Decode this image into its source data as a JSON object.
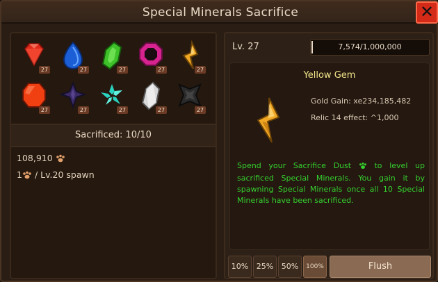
{
  "window": {
    "title": "Special Minerals Sacrifice",
    "close_label": "✕"
  },
  "left": {
    "gems": [
      {
        "name": "red-gem-icon",
        "count": "27",
        "color": "#e02a1a"
      },
      {
        "name": "blue-gem-icon",
        "count": "27",
        "color": "#1b5ed6"
      },
      {
        "name": "green-gem-icon",
        "count": "27",
        "color": "#3fc12a"
      },
      {
        "name": "pink-ring-gem-icon",
        "count": "27",
        "color": "#d6238f"
      },
      {
        "name": "yellow-gem-icon",
        "count": "27",
        "color": "#f0a824"
      },
      {
        "name": "orange-gem-icon",
        "count": "27",
        "color": "#f04012"
      },
      {
        "name": "purple-star-gem-icon",
        "count": "27",
        "color": "#3b2a66"
      },
      {
        "name": "cyan-shard-gem-icon",
        "count": "27",
        "color": "#2ad3c0"
      },
      {
        "name": "white-gem-icon",
        "count": "27",
        "color": "#d8d8d8"
      },
      {
        "name": "black-gem-icon",
        "count": "27",
        "color": "#2a2a2a"
      }
    ],
    "sacrificed_label": "Sacrificed: 10/10",
    "dust_amount": "108,910",
    "spawn_rate_prefix": "1",
    "spawn_rate_suffix": "/ Lv.20 spawn"
  },
  "right": {
    "level_label": "Lv. 27",
    "xp_text": "7,574/1,000,000",
    "xp_fraction": 0.0076,
    "selected_gem": "Yellow Gem",
    "gold_gain": "Gold Gain: xe234,185,482",
    "relic_effect": "Relic 14 effect: ^1,000",
    "desc_part1": "Spend your Sacrifice Dust",
    "desc_part2": "to level up sacrificed Special Minerals. You gain it by spawning Special Minerals once all 10 Special Minerals have been sacrificed.",
    "buttons": [
      "10%",
      "25%",
      "50%",
      "100%"
    ],
    "flush_label": "Flush",
    "accent_green": "#35d12f",
    "accent_title": "#f3e68a"
  }
}
